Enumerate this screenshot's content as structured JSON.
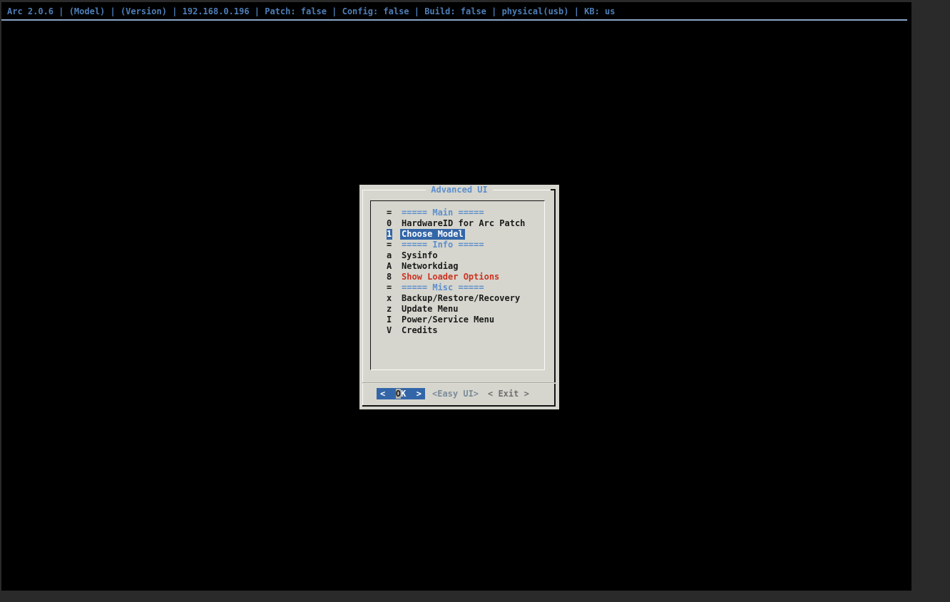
{
  "colors": {
    "frame_gray": "#2a2a2a",
    "console_black": "#000000",
    "steel_text": "#4d7eb8",
    "steel_line": "#8aa5c8",
    "dialog_bg": "#d6d6ce",
    "selection_blue": "#3366a8",
    "section_blue": "#5e8fcc",
    "warning_red": "#cc3322",
    "text_dark": "#1a1a1a",
    "cursor_gray": "#b4b4ac",
    "easyui_gray": "#7b8b99",
    "button_inactive": "#6f6f6f"
  },
  "status_bar": {
    "text": "Arc 2.0.6 | (Model) | (Version) | 192.168.0.196 | Patch: false | Config: false | Build: false | physical(usb) | KB: us"
  },
  "dialog": {
    "title": "Advanced UI",
    "menu_items": [
      {
        "key": "=",
        "label": "===== Main =====",
        "type": "section"
      },
      {
        "key": "0",
        "label": "HardwareID for Arc Patch",
        "type": "normal"
      },
      {
        "key": "1",
        "label": "Choose Model",
        "type": "selected"
      },
      {
        "key": "=",
        "label": "===== Info =====",
        "type": "section"
      },
      {
        "key": "a",
        "label": "Sysinfo",
        "type": "normal"
      },
      {
        "key": "A",
        "label": "Networkdiag",
        "type": "normal"
      },
      {
        "key": "8",
        "label": "Show Loader Options",
        "type": "warning"
      },
      {
        "key": "=",
        "label": "===== Misc =====",
        "type": "section"
      },
      {
        "key": "x",
        "label": "Backup/Restore/Recovery",
        "type": "normal"
      },
      {
        "key": "z",
        "label": "Update Menu",
        "type": "normal"
      },
      {
        "key": "I",
        "label": "Power/Service Menu",
        "type": "normal"
      },
      {
        "key": "V",
        "label": "Credits",
        "type": "normal"
      }
    ],
    "buttons": {
      "ok": {
        "open": "<",
        "cursor_char": "O",
        "rest": "K",
        "close": ">"
      },
      "easy_ui": {
        "label": "<Easy UI>"
      },
      "exit": {
        "label": "< Exit >"
      }
    }
  }
}
